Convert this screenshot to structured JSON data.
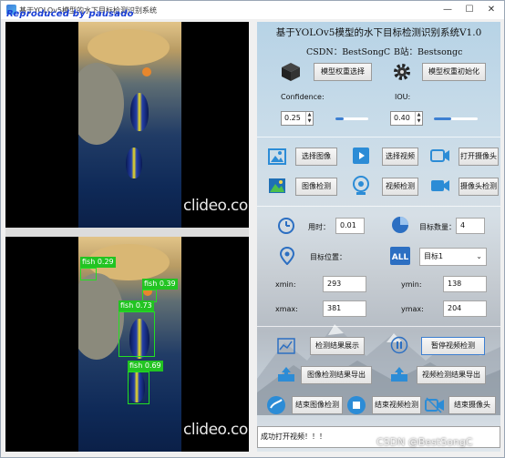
{
  "window": {
    "title": "基于YOLOv5模型的水下目标检测识别系统",
    "watermark": "Reproduced by pausado",
    "controls": {
      "minimize": "—",
      "maximize": "☐",
      "close": "✕"
    }
  },
  "left": {
    "video_watermark_top": "clideo.com",
    "video_watermark_bottom": "clideo.com",
    "detections": [
      {
        "label": "fish 0.29"
      },
      {
        "label": "fish 0.39"
      },
      {
        "label": "fish 0.73"
      },
      {
        "label": "fish 0.69"
      }
    ]
  },
  "right": {
    "title": "基于YOLOv5模型的水下目标检测识别系统V1.0",
    "csdn": "CSDN：BestSongC",
    "bilibili": "B站：Bestsongc",
    "model": {
      "select_button": "模型权重选择",
      "init_button": "模型权重初始化"
    },
    "confidence": {
      "label": "Confidence:",
      "value": "0.25",
      "level": 0.25
    },
    "iou": {
      "label": "IOU:",
      "value": "0.40",
      "level": 0.4
    },
    "media": {
      "select_image": "选择图像",
      "select_video": "选择视频",
      "open_camera": "打开摄像头",
      "image_detect": "图像检测",
      "video_detect": "视频检测",
      "camera_detect": "摄像头检测"
    },
    "stats": {
      "time_label": "用时：",
      "time_value": "0.01",
      "count_label": "目标数量：",
      "count_value": "4",
      "position_label": "目标位置：",
      "target_select": "目标1",
      "xmin_label": "xmin:",
      "xmin_value": "293",
      "ymin_label": "ymin:",
      "ymin_value": "138",
      "xmax_label": "xmax:",
      "xmax_value": "381",
      "ymax_label": "ymax:",
      "ymax_value": "204"
    },
    "actions": {
      "show_results": "检测结果展示",
      "pause_video": "暂停视频检测",
      "export_image": "图像检测结果导出",
      "export_video": "视频检测结果导出",
      "end_image": "结束图像检测",
      "end_video": "结束视频检测",
      "end_camera": "结束摄像头"
    },
    "status": "成功打开视频！！！"
  },
  "footer_watermark": "CSDN @BestSongC",
  "colors": {
    "bbox": "#22e022",
    "accent": "#3d7fd1"
  }
}
